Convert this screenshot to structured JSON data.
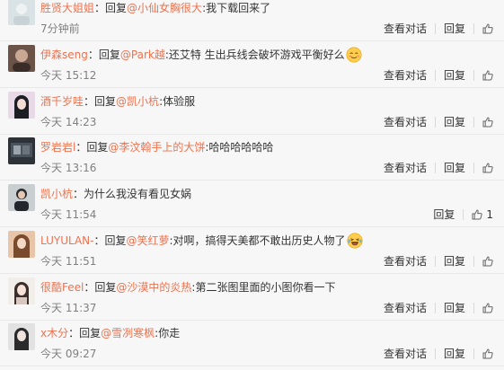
{
  "labels": {
    "view_conversation": "查看对话",
    "reply": "回复",
    "reply_prefix": "回复"
  },
  "comments": [
    {
      "user": "胜贤大姐姐",
      "prefix": "：",
      "mention": "@小仙女胸很大",
      "text": ":我下载回来了",
      "emoji": "",
      "time": "7分钟前",
      "view": true,
      "likes": ""
    },
    {
      "user": "伊森seng",
      "prefix": "：",
      "mention": "@Park越",
      "text": ":还艾特 生出兵线会破坏游戏平衡好么",
      "emoji": "relieved-emoji",
      "time": "今天 15:12",
      "view": true,
      "likes": ""
    },
    {
      "user": "酒千岁哇",
      "prefix": "：",
      "mention": "@凯小杭",
      "text": ":体验服",
      "emoji": "",
      "time": "今天 14:23",
      "view": true,
      "likes": ""
    },
    {
      "user": "罗岩岩l",
      "prefix": "：",
      "mention": "@李汶翰手上的大饼",
      "text": ":哈哈哈哈哈哈",
      "emoji": "",
      "time": "今天 13:16",
      "view": true,
      "likes": ""
    },
    {
      "user": "凯小杭",
      "prefix": "：",
      "mention": "",
      "text": "为什么我没有看见女娲",
      "emoji": "",
      "time": "今天 11:54",
      "view": false,
      "likes": "1"
    },
    {
      "user": "LUYULAN-",
      "prefix": "：",
      "mention": "@笑红萝",
      "text": ":对啊，搞得天美都不敢出历史人物了",
      "emoji": "laughing-emoji",
      "time": "今天 11:51",
      "view": true,
      "likes": ""
    },
    {
      "user": "很酷Feel",
      "prefix": "：",
      "mention": "@沙漠中的炎热",
      "text": ":第二张图里面的小图你看一下",
      "emoji": "",
      "time": "今天 11:37",
      "view": true,
      "likes": ""
    },
    {
      "user": "x木分",
      "prefix": "：",
      "mention": "@雪冽寒枫",
      "text": ":你走",
      "emoji": "",
      "time": "今天 09:27",
      "view": true,
      "likes": ""
    }
  ],
  "colors": {
    "username": "#eb7350",
    "text": "#333333",
    "time": "#808080",
    "background": "#f7f7f7"
  }
}
